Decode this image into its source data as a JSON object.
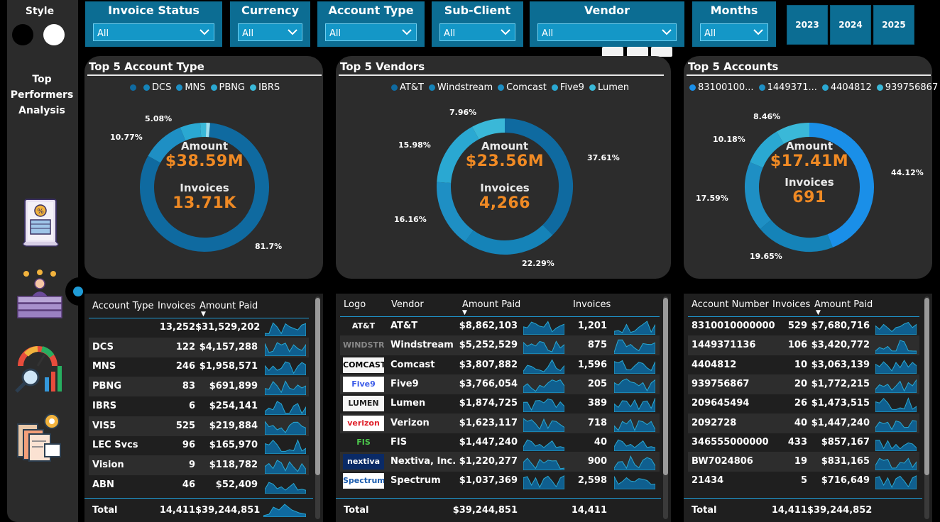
{
  "rail": {
    "style_label": "Style",
    "title_lines": [
      "Top",
      "Performers",
      "Analysis"
    ],
    "nav_icons": [
      "invoice-document-icon",
      "top-performers-podium-icon",
      "analytics-gauge-icon",
      "reports-settings-icon"
    ]
  },
  "slicers": [
    {
      "title": "Invoice Status",
      "value": "All"
    },
    {
      "title": "Currency",
      "value": "All"
    },
    {
      "title": "Account Type",
      "value": "All"
    },
    {
      "title": "Sub-Client",
      "value": "All"
    },
    {
      "title": "Vendor",
      "value": "All"
    },
    {
      "title": "Months",
      "value": "All"
    }
  ],
  "years": [
    "2023",
    "2024",
    "2025"
  ],
  "cards": {
    "account_type": {
      "title": "Top 5 Account Type",
      "legend": [
        "",
        "DCS",
        "MNS",
        "PBNG",
        "IBRS"
      ],
      "center": {
        "k1": "Amount",
        "v1": "$38.59M",
        "k2": "Invoices",
        "v2": "13.71K"
      },
      "labels": [
        "5.08%",
        "10.77%",
        "81.7%"
      ]
    },
    "vendors": {
      "title": "Top 5 Vendors",
      "legend": [
        "AT&T",
        "Windstream",
        "Comcast",
        "Five9",
        "Lumen"
      ],
      "center": {
        "k1": "Amount",
        "v1": "$23.56M",
        "k2": "Invoices",
        "v2": "4,266"
      },
      "labels": [
        "7.96%",
        "15.98%",
        "37.61%",
        "16.16%",
        "22.29%"
      ]
    },
    "accounts": {
      "title": "Top 5 Accounts",
      "legend": [
        "83100100...",
        "1449371...",
        "4404812",
        "939756867"
      ],
      "center": {
        "k1": "Amount",
        "v1": "$17.41M",
        "k2": "Invoices",
        "v2": "691"
      },
      "labels": [
        "8.46%",
        "10.18%",
        "44.12%",
        "17.59%",
        "19.65%"
      ]
    }
  },
  "donut_data": {
    "account_type": [
      81.7,
      10.77,
      5.08,
      1.5,
      0.95
    ],
    "vendors": [
      37.61,
      22.29,
      16.16,
      15.98,
      7.96
    ],
    "accounts": [
      44.12,
      19.65,
      17.59,
      10.18,
      8.46
    ]
  },
  "colors": {
    "accent": "#0c6d93",
    "orange": "#f08a24",
    "donut_shades": [
      "#0f6aa0",
      "#1583b8",
      "#1e8fc4",
      "#2aa8d2",
      "#3ab8d8"
    ],
    "accounts_main": "#1a8fe8"
  },
  "table_account_type": {
    "headers": [
      "Account Type",
      "Invoices",
      "Amount Paid"
    ],
    "rows": [
      [
        "",
        "13,252",
        "$31,529,202"
      ],
      [
        "DCS",
        "122",
        "$4,157,288"
      ],
      [
        "MNS",
        "246",
        "$1,958,571"
      ],
      [
        "PBNG",
        "83",
        "$691,899"
      ],
      [
        "IBRS",
        "6",
        "$254,141"
      ],
      [
        "VIS5",
        "525",
        "$219,884"
      ],
      [
        "LEC Svcs",
        "96",
        "$165,970"
      ],
      [
        "Vision",
        "9",
        "$118,782"
      ],
      [
        "ABN",
        "46",
        "$52,409"
      ]
    ],
    "total": [
      "Total",
      "14,411",
      "$39,244,851"
    ]
  },
  "table_vendors": {
    "headers": [
      "Logo",
      "Vendor",
      "Amount Paid",
      "Invoices"
    ],
    "rows": [
      [
        "AT&T",
        "AT&T",
        "$8,862,103",
        "1,201"
      ],
      [
        "WINDSTREAM",
        "Windstream",
        "$5,252,529",
        "875"
      ],
      [
        "COMCAST",
        "Comcast",
        "$3,807,882",
        "1,596"
      ],
      [
        "Five9",
        "Five9",
        "$3,766,054",
        "205"
      ],
      [
        "LUMEN",
        "Lumen",
        "$1,874,725",
        "389"
      ],
      [
        "verizon",
        "Verizon",
        "$1,623,117",
        "718"
      ],
      [
        "FIS",
        "FIS",
        "$1,447,240",
        "40"
      ],
      [
        "nextiva",
        "Nextiva, Inc.",
        "$1,220,277",
        "900"
      ],
      [
        "Spectrum",
        "Spectrum",
        "$1,037,369",
        "2,598"
      ]
    ],
    "total": [
      "Total",
      "$39,244,851",
      "14,411"
    ]
  },
  "table_accounts": {
    "headers": [
      "Account Number",
      "Invoices",
      "Amount Paid"
    ],
    "rows": [
      [
        "8310010000000",
        "529",
        "$7,680,716"
      ],
      [
        "1449371136",
        "106",
        "$3,420,772"
      ],
      [
        "4404812",
        "10",
        "$3,063,139"
      ],
      [
        "939756867",
        "20",
        "$1,772,215"
      ],
      [
        "209645494",
        "26",
        "$1,473,515"
      ],
      [
        "2092728",
        "40",
        "$1,447,240"
      ],
      [
        "346555000000",
        "433",
        "$857,167"
      ],
      [
        "BW7024806",
        "19",
        "$831,165"
      ],
      [
        "21434",
        "5",
        "$716,649"
      ]
    ],
    "total": [
      "Total",
      "14,411",
      "$39,244,852"
    ]
  }
}
